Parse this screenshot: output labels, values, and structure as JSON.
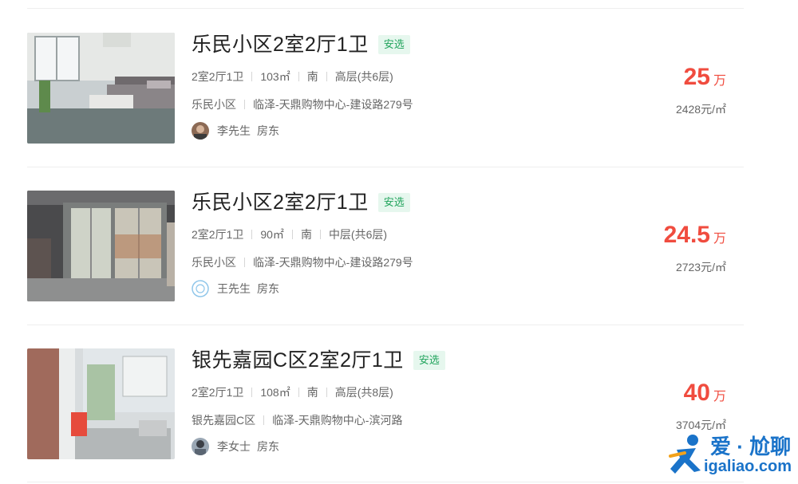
{
  "listings": [
    {
      "title": "乐民小区2室2厅1卫",
      "badge": "安选",
      "layout": "2室2厅1卫",
      "area": "103㎡",
      "orientation": "南",
      "floor": "高层(共6层)",
      "community": "乐民小区",
      "location": "临泽-天鼎购物中心-建设路279号",
      "owner_name": "李先生",
      "owner_role": "房东",
      "price": "25",
      "price_unit": "万",
      "unit_price": "2428元/㎡"
    },
    {
      "title": "乐民小区2室2厅1卫",
      "badge": "安选",
      "layout": "2室2厅1卫",
      "area": "90㎡",
      "orientation": "南",
      "floor": "中层(共6层)",
      "community": "乐民小区",
      "location": "临泽-天鼎购物中心-建设路279号",
      "owner_name": "王先生",
      "owner_role": "房东",
      "price": "24.5",
      "price_unit": "万",
      "unit_price": "2723元/㎡"
    },
    {
      "title": "银先嘉园C区2室2厅1卫",
      "badge": "安选",
      "layout": "2室2厅1卫",
      "area": "108㎡",
      "orientation": "南",
      "floor": "高层(共8层)",
      "community": "银先嘉园C区",
      "location": "临泽-天鼎购物中心-滨河路",
      "owner_name": "李女士",
      "owner_role": "房东",
      "price": "40",
      "price_unit": "万",
      "unit_price": "3704元/㎡"
    }
  ],
  "watermark": {
    "line1": "爱 · 尬聊",
    "line2": "igaliao.com"
  },
  "colors": {
    "price": "#f04c3f",
    "badge_bg": "#e6f7ee",
    "badge_text": "#22a45d",
    "watermark": "#1a73c9"
  }
}
